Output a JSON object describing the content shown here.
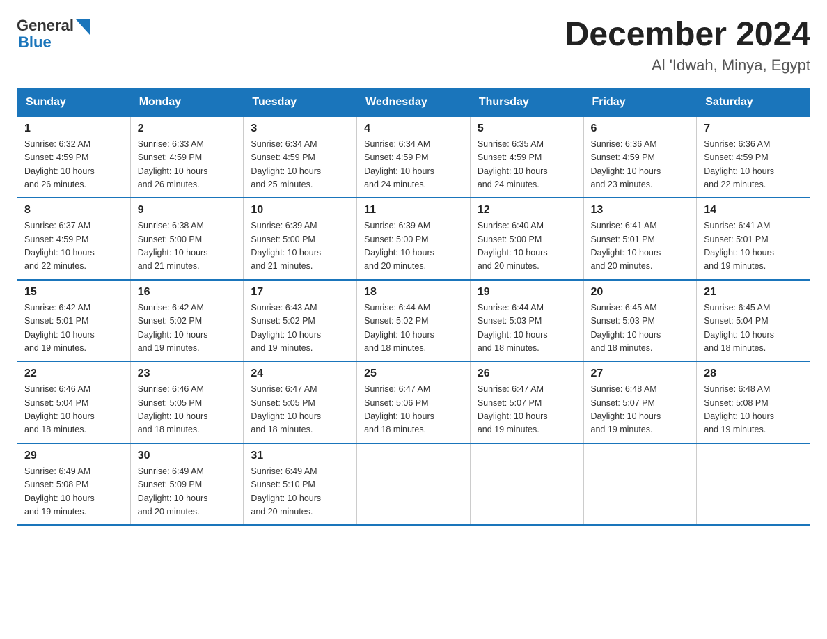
{
  "header": {
    "logo_general": "General",
    "logo_blue": "Blue",
    "month_title": "December 2024",
    "location": "Al 'Idwah, Minya, Egypt"
  },
  "days_of_week": [
    "Sunday",
    "Monday",
    "Tuesday",
    "Wednesday",
    "Thursday",
    "Friday",
    "Saturday"
  ],
  "weeks": [
    [
      {
        "day": "1",
        "sunrise": "6:32 AM",
        "sunset": "4:59 PM",
        "daylight": "10 hours and 26 minutes."
      },
      {
        "day": "2",
        "sunrise": "6:33 AM",
        "sunset": "4:59 PM",
        "daylight": "10 hours and 26 minutes."
      },
      {
        "day": "3",
        "sunrise": "6:34 AM",
        "sunset": "4:59 PM",
        "daylight": "10 hours and 25 minutes."
      },
      {
        "day": "4",
        "sunrise": "6:34 AM",
        "sunset": "4:59 PM",
        "daylight": "10 hours and 24 minutes."
      },
      {
        "day": "5",
        "sunrise": "6:35 AM",
        "sunset": "4:59 PM",
        "daylight": "10 hours and 24 minutes."
      },
      {
        "day": "6",
        "sunrise": "6:36 AM",
        "sunset": "4:59 PM",
        "daylight": "10 hours and 23 minutes."
      },
      {
        "day": "7",
        "sunrise": "6:36 AM",
        "sunset": "4:59 PM",
        "daylight": "10 hours and 22 minutes."
      }
    ],
    [
      {
        "day": "8",
        "sunrise": "6:37 AM",
        "sunset": "4:59 PM",
        "daylight": "10 hours and 22 minutes."
      },
      {
        "day": "9",
        "sunrise": "6:38 AM",
        "sunset": "5:00 PM",
        "daylight": "10 hours and 21 minutes."
      },
      {
        "day": "10",
        "sunrise": "6:39 AM",
        "sunset": "5:00 PM",
        "daylight": "10 hours and 21 minutes."
      },
      {
        "day": "11",
        "sunrise": "6:39 AM",
        "sunset": "5:00 PM",
        "daylight": "10 hours and 20 minutes."
      },
      {
        "day": "12",
        "sunrise": "6:40 AM",
        "sunset": "5:00 PM",
        "daylight": "10 hours and 20 minutes."
      },
      {
        "day": "13",
        "sunrise": "6:41 AM",
        "sunset": "5:01 PM",
        "daylight": "10 hours and 20 minutes."
      },
      {
        "day": "14",
        "sunrise": "6:41 AM",
        "sunset": "5:01 PM",
        "daylight": "10 hours and 19 minutes."
      }
    ],
    [
      {
        "day": "15",
        "sunrise": "6:42 AM",
        "sunset": "5:01 PM",
        "daylight": "10 hours and 19 minutes."
      },
      {
        "day": "16",
        "sunrise": "6:42 AM",
        "sunset": "5:02 PM",
        "daylight": "10 hours and 19 minutes."
      },
      {
        "day": "17",
        "sunrise": "6:43 AM",
        "sunset": "5:02 PM",
        "daylight": "10 hours and 19 minutes."
      },
      {
        "day": "18",
        "sunrise": "6:44 AM",
        "sunset": "5:02 PM",
        "daylight": "10 hours and 18 minutes."
      },
      {
        "day": "19",
        "sunrise": "6:44 AM",
        "sunset": "5:03 PM",
        "daylight": "10 hours and 18 minutes."
      },
      {
        "day": "20",
        "sunrise": "6:45 AM",
        "sunset": "5:03 PM",
        "daylight": "10 hours and 18 minutes."
      },
      {
        "day": "21",
        "sunrise": "6:45 AM",
        "sunset": "5:04 PM",
        "daylight": "10 hours and 18 minutes."
      }
    ],
    [
      {
        "day": "22",
        "sunrise": "6:46 AM",
        "sunset": "5:04 PM",
        "daylight": "10 hours and 18 minutes."
      },
      {
        "day": "23",
        "sunrise": "6:46 AM",
        "sunset": "5:05 PM",
        "daylight": "10 hours and 18 minutes."
      },
      {
        "day": "24",
        "sunrise": "6:47 AM",
        "sunset": "5:05 PM",
        "daylight": "10 hours and 18 minutes."
      },
      {
        "day": "25",
        "sunrise": "6:47 AM",
        "sunset": "5:06 PM",
        "daylight": "10 hours and 18 minutes."
      },
      {
        "day": "26",
        "sunrise": "6:47 AM",
        "sunset": "5:07 PM",
        "daylight": "10 hours and 19 minutes."
      },
      {
        "day": "27",
        "sunrise": "6:48 AM",
        "sunset": "5:07 PM",
        "daylight": "10 hours and 19 minutes."
      },
      {
        "day": "28",
        "sunrise": "6:48 AM",
        "sunset": "5:08 PM",
        "daylight": "10 hours and 19 minutes."
      }
    ],
    [
      {
        "day": "29",
        "sunrise": "6:49 AM",
        "sunset": "5:08 PM",
        "daylight": "10 hours and 19 minutes."
      },
      {
        "day": "30",
        "sunrise": "6:49 AM",
        "sunset": "5:09 PM",
        "daylight": "10 hours and 20 minutes."
      },
      {
        "day": "31",
        "sunrise": "6:49 AM",
        "sunset": "5:10 PM",
        "daylight": "10 hours and 20 minutes."
      },
      null,
      null,
      null,
      null
    ]
  ],
  "labels": {
    "sunrise": "Sunrise:",
    "sunset": "Sunset:",
    "daylight": "Daylight:"
  }
}
